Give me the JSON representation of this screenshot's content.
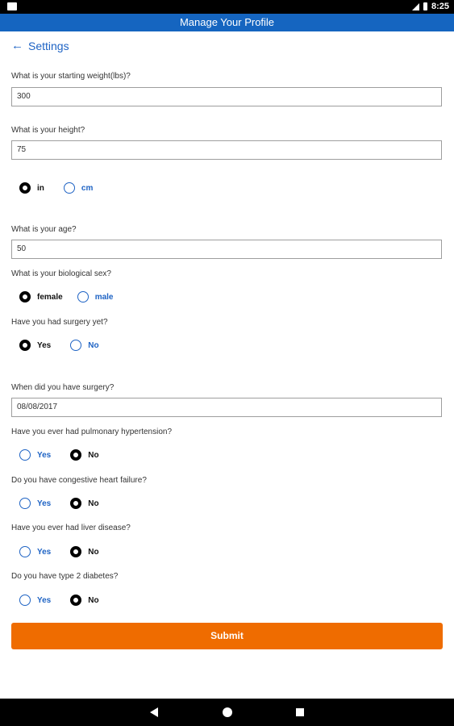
{
  "status": {
    "time": "8:25"
  },
  "app_bar": {
    "title": "Manage Your Profile"
  },
  "nav": {
    "back_label": "Settings"
  },
  "form": {
    "weight": {
      "question": "What is your starting weight(lbs)?",
      "value": "300"
    },
    "height": {
      "question": "What is your height?",
      "value": "75",
      "units": [
        "in",
        "cm"
      ],
      "unit_selected": "in"
    },
    "age": {
      "question": "What is your age?",
      "value": "50"
    },
    "sex": {
      "question": "What is your biological sex?",
      "options": [
        "female",
        "male"
      ],
      "selected": "female"
    },
    "surgery": {
      "question": "Have you had surgery yet?",
      "options": [
        "Yes",
        "No"
      ],
      "selected": "Yes"
    },
    "surgery_date": {
      "question": "When did you have surgery?",
      "value": "08/08/2017"
    },
    "pulmonary": {
      "question": "Have you ever had pulmonary hypertension?",
      "options": [
        "Yes",
        "No"
      ],
      "selected": "No"
    },
    "heart_failure": {
      "question": "Do you have congestive heart failure?",
      "options": [
        "Yes",
        "No"
      ],
      "selected": "No"
    },
    "liver": {
      "question": "Have you ever had liver disease?",
      "options": [
        "Yes",
        "No"
      ],
      "selected": "No"
    },
    "diabetes": {
      "question": "Do you have type 2 diabetes?",
      "options": [
        "Yes",
        "No"
      ],
      "selected": "No"
    },
    "submit_label": "Submit"
  },
  "colors": {
    "primary": "#1565c0",
    "accent": "#ef6c00",
    "link": "#1e63c4"
  }
}
